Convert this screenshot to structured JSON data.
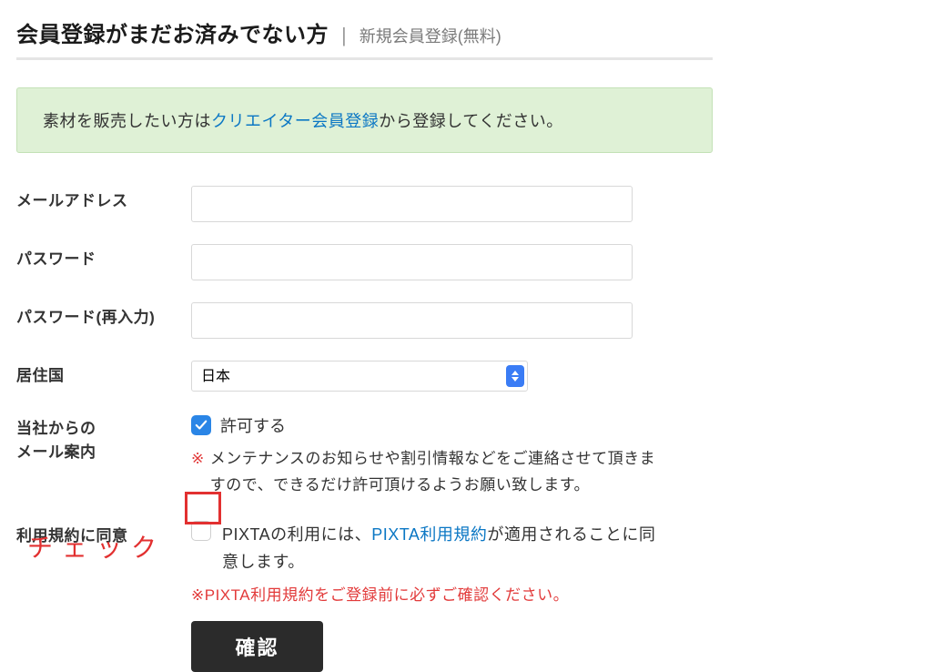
{
  "heading": {
    "title": "会員登録がまだお済みでない方",
    "separator": "|",
    "subtitle": "新規会員登録(無料)"
  },
  "notice": {
    "prefix": "素材を販売したい方は",
    "link": "クリエイター会員登録",
    "suffix": "から登録してください。"
  },
  "form": {
    "email_label": "メールアドレス",
    "password_label": "パスワード",
    "password_confirm_label": "パスワード(再入力)",
    "country_label": "居住国",
    "country_value": "日本",
    "mail_opt_label_line1": "当社からの",
    "mail_opt_label_line2": "メール案内",
    "mail_opt_permit": "許可する",
    "mail_opt_note": "メンテナンスのお知らせや割引情報などをご連絡させて頂きますので、できるだけ許可頂けるようお願い致します。",
    "terms_label": "利用規約に同意",
    "terms_text_prefix": "PIXTAの利用には、",
    "terms_link": "PIXTA利用規約",
    "terms_text_suffix": "が適用されることに同意します。",
    "terms_warning": "※PIXTA利用規約をご登録前に必ずご確認ください。",
    "confirm_button": "確認",
    "asterisk": "※"
  },
  "annotation": {
    "check_text": "チェック"
  }
}
